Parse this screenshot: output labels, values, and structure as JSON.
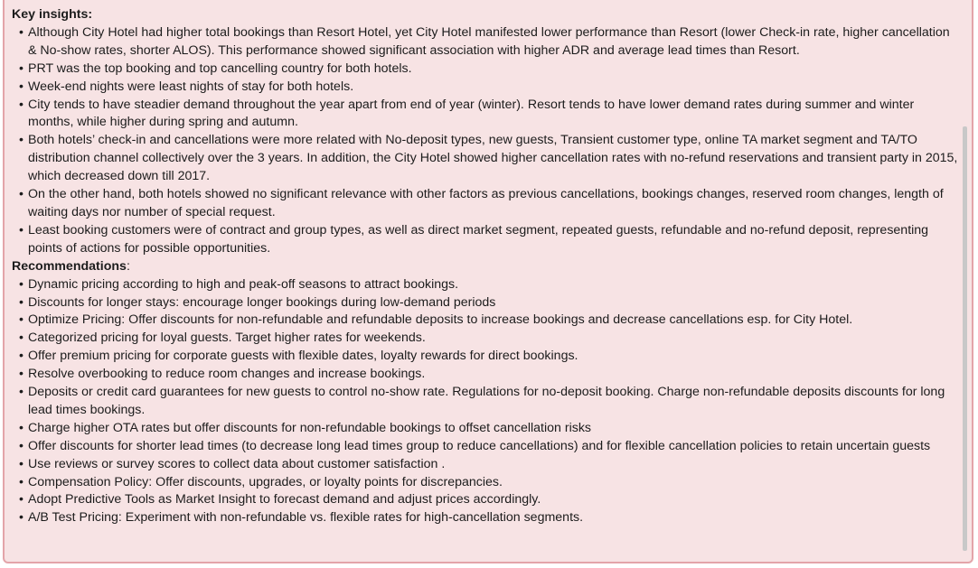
{
  "key_insights": {
    "heading": "Key insights:",
    "items": [
      "Although City Hotel had higher total bookings than Resort Hotel, yet City Hotel manifested lower performance than Resort (lower Check-in rate, higher cancellation & No-show rates, shorter ALOS). This performance showed significant association with higher ADR and average lead times than Resort.",
      "PRT was the top booking and top cancelling country for both hotels.",
      "Week-end nights were least nights of stay for both hotels.",
      "City tends to have steadier demand throughout the year apart from end of year (winter). Resort tends to have lower demand rates during summer and winter months, while higher during spring and autumn.",
      "Both hotels’ check-in and cancellations were more related with No-deposit types, new guests, Transient customer type, online TA market segment and TA/TO distribution channel collectively over the 3 years. In addition, the City Hotel showed higher cancellation rates with no-refund reservations and transient party in 2015, which decreased down till 2017.",
      "On the other hand, both hotels showed no significant relevance with other factors as previous cancellations, bookings changes, reserved room changes, length of waiting days nor number of special request.",
      "Least booking customers were of contract and group types, as well as direct market segment, repeated guests, refundable and no-refund deposit, representing points of actions for possible opportunities."
    ]
  },
  "recommendations": {
    "heading": "Recommendations",
    "colon": ":",
    "items": [
      "Dynamic pricing according to high and peak-off seasons to attract bookings.",
      "Discounts for longer stays: encourage longer bookings during low-demand periods",
      "Optimize Pricing: Offer discounts for non-refundable and refundable deposits to increase bookings and decrease cancellations esp. for City Hotel.",
      "Categorized pricing for loyal guests. Target higher rates for weekends.",
      "Offer premium pricing for corporate guests with flexible dates, loyalty rewards for direct bookings.",
      "Resolve overbooking to reduce room changes and increase bookings.",
      "Deposits or credit card guarantees for new guests to control no-show rate. Regulations for no-deposit booking. Charge non-refundable deposits discounts for long lead times bookings.",
      "Charge higher OTA rates but offer discounts for non-refundable bookings to offset cancellation risks",
      "Offer discounts for shorter lead times (to decrease long lead times group to reduce cancellations) and for flexible cancellation policies to retain uncertain guests",
      "Use reviews or survey scores to collect data about customer satisfaction .",
      "Compensation Policy: Offer discounts, upgrades, or loyalty points for discrepancies.",
      "Adopt Predictive Tools as Market Insight to forecast demand and adjust prices accordingly.",
      "A/B Test Pricing: Experiment with non-refundable vs. flexible rates for high-cancellation segments."
    ]
  }
}
